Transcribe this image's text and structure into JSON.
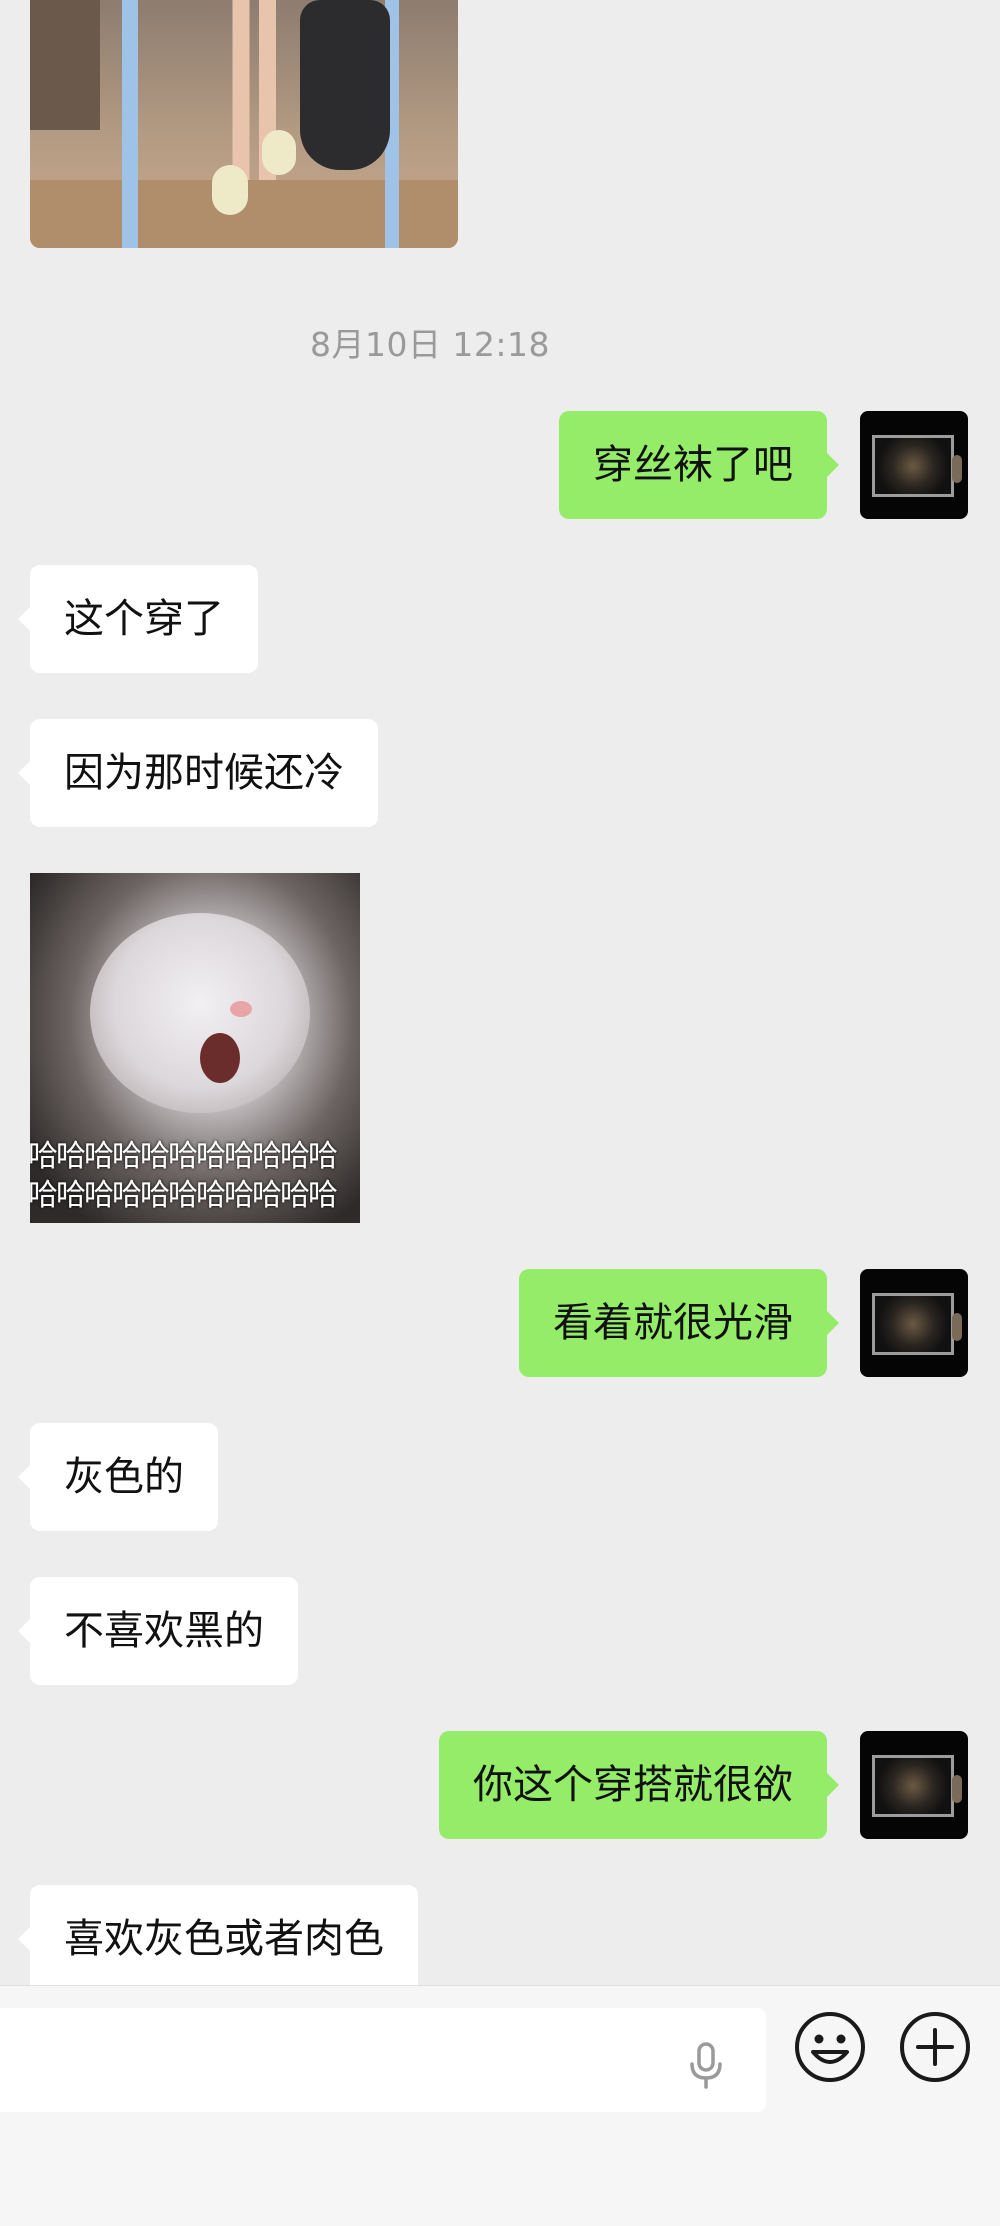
{
  "timestamp": "8月10日 12:18",
  "messages": [
    {
      "side": "right",
      "text": "穿丝袜了吧"
    },
    {
      "side": "left",
      "text": "这个穿了"
    },
    {
      "side": "left",
      "text": "因为那时候还冷"
    },
    {
      "side": "left",
      "type": "sticker",
      "caption_line1": "哈哈哈哈哈哈哈哈哈哈哈",
      "caption_line2": "哈哈哈哈哈哈哈哈哈哈哈"
    },
    {
      "side": "right",
      "text": "看着就很光滑"
    },
    {
      "side": "left",
      "text": "灰色的"
    },
    {
      "side": "left",
      "text": "不喜欢黑的"
    },
    {
      "side": "right",
      "text": "你这个穿搭就很欲"
    },
    {
      "side": "left",
      "text": "喜欢灰色或者肉色"
    }
  ],
  "input_bar": {
    "icons": [
      "microphone-icon",
      "emoji-icon",
      "plus-icon"
    ]
  },
  "colors": {
    "background": "#ededed",
    "outgoing_bubble": "#95ec69",
    "incoming_bubble": "#ffffff",
    "timestamp_text": "#9a9a9a"
  }
}
